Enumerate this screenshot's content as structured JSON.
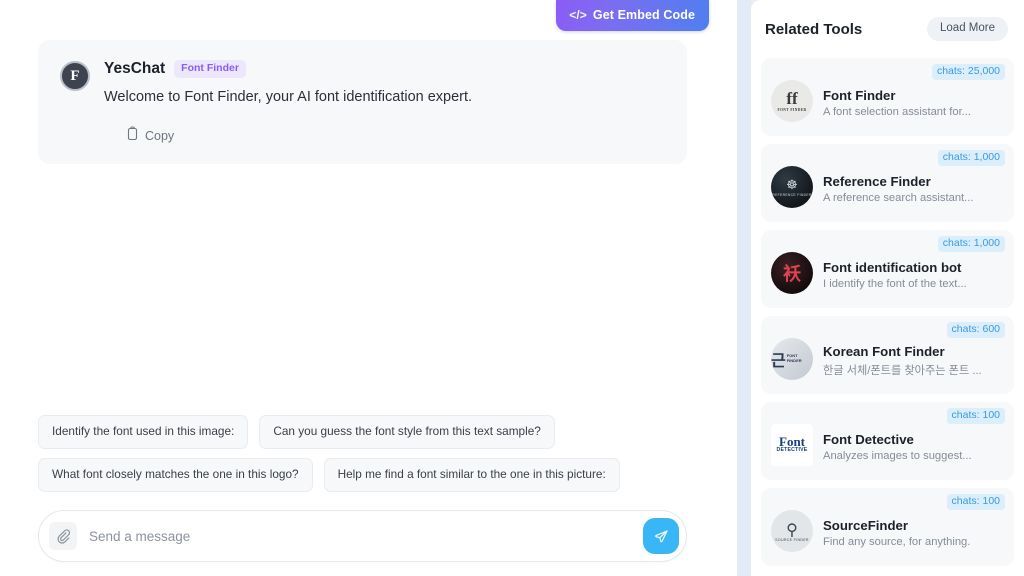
{
  "embed": {
    "label": "Get Embed Code",
    "icon": "code-icon",
    "glyph": "</>"
  },
  "message": {
    "avatar_letter": "F",
    "bot_name": "YesChat",
    "bot_tag": "Font Finder",
    "text": "Welcome to Font Finder, your AI font identification expert.",
    "copy_label": "Copy",
    "copy_icon": "clipboard-icon"
  },
  "suggestions": [
    "Identify the font used in this image:",
    "Can you guess the font style from this text sample?",
    "What font closely matches the one in this logo?",
    "Help me find a font similar to the one in this picture:"
  ],
  "composer": {
    "placeholder": "Send a message",
    "value": "",
    "attach_icon": "paperclip-icon",
    "send_icon": "send-plane-icon"
  },
  "sidebar": {
    "title": "Related Tools",
    "load_more": "Load More",
    "tools": [
      {
        "name": "Font Finder",
        "desc": "A font selection assistant for...",
        "chats": "chats: 25,000",
        "avatar_text": "ff",
        "avatar_sub": "FONT FINDER",
        "avatar_style": "ico-ff"
      },
      {
        "name": "Reference Finder",
        "desc": "A reference search assistant...",
        "chats": "chats: 1,000",
        "avatar_text": "☸",
        "avatar_sub": "REFERENCE FINDER",
        "avatar_style": "ico-ref"
      },
      {
        "name": "Font identification bot",
        "desc": "I identify the font of the text...",
        "chats": "chats: 1,000",
        "avatar_text": "袄",
        "avatar_sub": "",
        "avatar_style": "ico-cjk"
      },
      {
        "name": "Korean Font Finder",
        "desc": "한글 서체/폰트를 찾아주는 폰트 ...",
        "chats": "chats: 600",
        "avatar_text": "근",
        "avatar_sub": "FONT FINDER",
        "avatar_style": "ico-kr"
      },
      {
        "name": "Font Detective",
        "desc": "Analyzes images to suggest...",
        "chats": "chats: 100",
        "avatar_text": "Font",
        "avatar_sub": "DETECTIVE",
        "avatar_style": "ico-det"
      },
      {
        "name": "SourceFinder",
        "desc": "Find any source, for anything.",
        "chats": "chats: 100",
        "avatar_text": "⚲",
        "avatar_sub": "SOURCE FINDER",
        "avatar_style": "ico-src"
      }
    ]
  },
  "colors": {
    "embed_from": "#8b5cf6",
    "embed_to": "#4f7ff0",
    "send_blue": "#38b6f5",
    "tag_purple": "#8b5cf6",
    "chats_blue": "#3c9ae0"
  }
}
